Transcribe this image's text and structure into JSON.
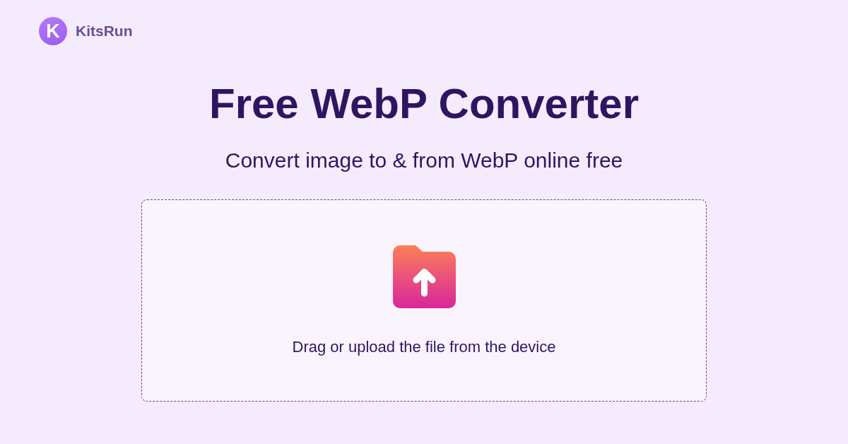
{
  "brand": {
    "mark": "K",
    "name": "KitsRun"
  },
  "title": "Free WebP Converter",
  "subtitle": "Convert image to & from WebP online free",
  "dropzone": {
    "text": "Drag or upload the file from the device"
  }
}
